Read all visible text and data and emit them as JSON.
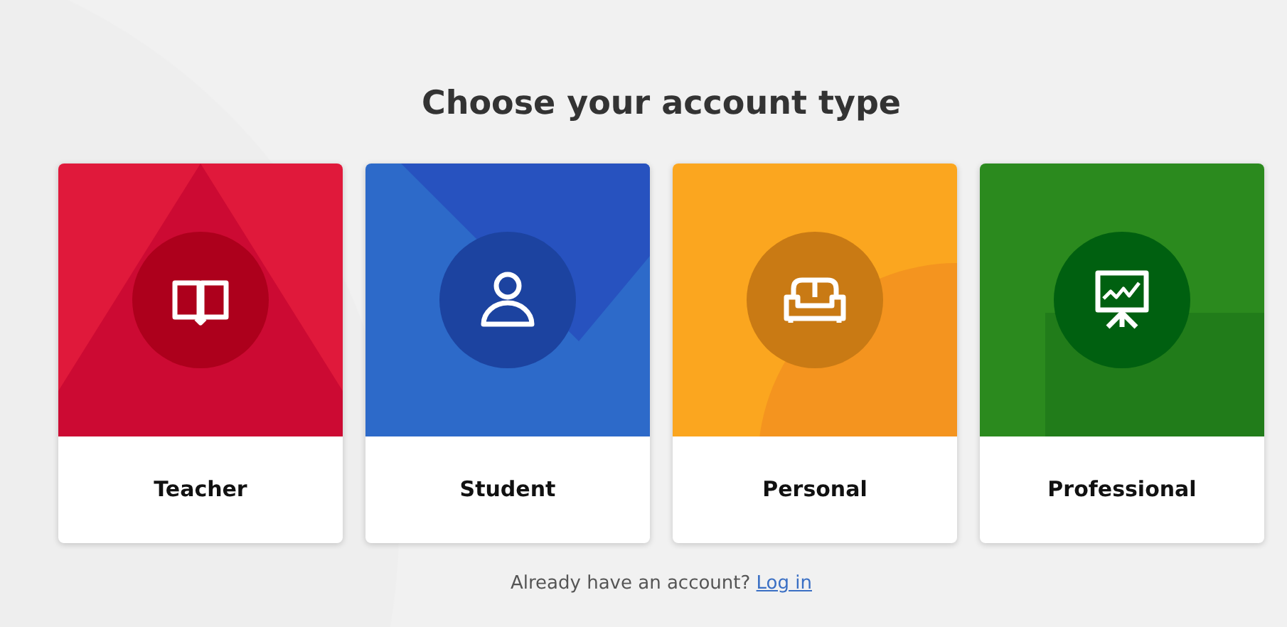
{
  "heading": "Choose your account type",
  "cards": [
    {
      "kind": "teacher",
      "label": "Teacher",
      "color": "#e0193b"
    },
    {
      "kind": "student",
      "label": "Student",
      "color": "#2d6ac9"
    },
    {
      "kind": "personal",
      "label": "Personal",
      "color": "#fba61f"
    },
    {
      "kind": "professional",
      "label": "Professional",
      "color": "#2b8a1e"
    }
  ],
  "footer": {
    "text": "Already have an account?",
    "link": "Log in"
  }
}
